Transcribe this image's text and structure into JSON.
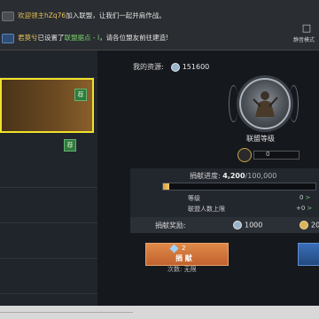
{
  "chat": {
    "line1": {
      "prefix": "欢迎",
      "role": "领主",
      "name": "hZq76",
      "suffix": "加入联盟，让我们一起并肩作战。"
    },
    "line2": {
      "name": "君莫兮",
      "text1": "已设置了",
      "place": "联盟据点 - I",
      "text2": "，请各位盟友前往建造!"
    },
    "mute_label": "静音模式"
  },
  "left_list": {
    "badge_label": "荐"
  },
  "resources": {
    "label": "我的资源:",
    "amount": "151600"
  },
  "alliance": {
    "level_title": "联盟等级",
    "level_value": "0"
  },
  "contribution": {
    "label": "捐献进度:",
    "current": "4,200",
    "max": "/100,000",
    "progress_fraction": 0.042,
    "stats": [
      {
        "label": "等级",
        "value": "0",
        "arrow": ">",
        "next": ""
      },
      {
        "label": "联盟人数上限",
        "value": "+0",
        "arrow": ">",
        "next": ""
      }
    ],
    "reward_label": "捐献奖励:",
    "reward_a": "1000",
    "reward_b": "20"
  },
  "donate": {
    "count_value": "2",
    "button_label": "捐 献",
    "times_label": "次数: 无限"
  },
  "colors": {
    "highlight": "#f0e22a",
    "accent_orange": "#c1622e",
    "progress": "#e0ab49"
  }
}
